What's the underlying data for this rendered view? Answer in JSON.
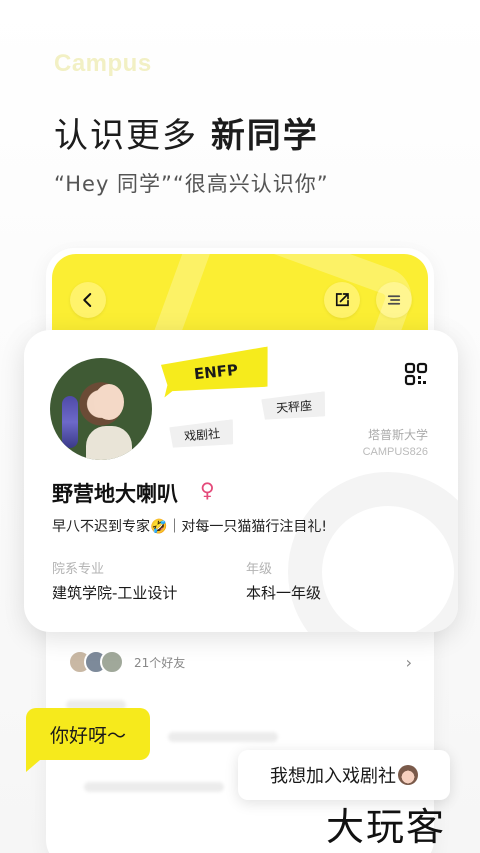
{
  "brand": "Campus",
  "headline": {
    "part1": "认识更多 ",
    "part2": "新同学"
  },
  "subline": "“Hey 同学”“很高兴认识你”",
  "header_icons": {
    "back": "chevron-left-icon",
    "share": "share-icon",
    "menu": "menu-icon"
  },
  "profile": {
    "mbti": "ENFP",
    "tags": [
      "天秤座",
      "戏剧社"
    ],
    "school": "塔普斯大学",
    "campus_id": "CAMPUS826",
    "name": "野营地大喇叭",
    "gender_symbol": "♀",
    "bio": "早八不迟到专家🤣｜对每一只猫猫行注目礼!",
    "fields": [
      {
        "label": "院系专业",
        "value": "建筑学院-工业设计"
      },
      {
        "label": "年级",
        "value": "本科一年级"
      }
    ]
  },
  "friends": {
    "label": "21个好友"
  },
  "bubbles": {
    "hello": "你好呀～",
    "join": "我想加入戏剧社"
  },
  "watermark": "大玩客",
  "colors": {
    "accent_yellow": "#f6ea1c",
    "gender_pink": "#e44a7a"
  }
}
